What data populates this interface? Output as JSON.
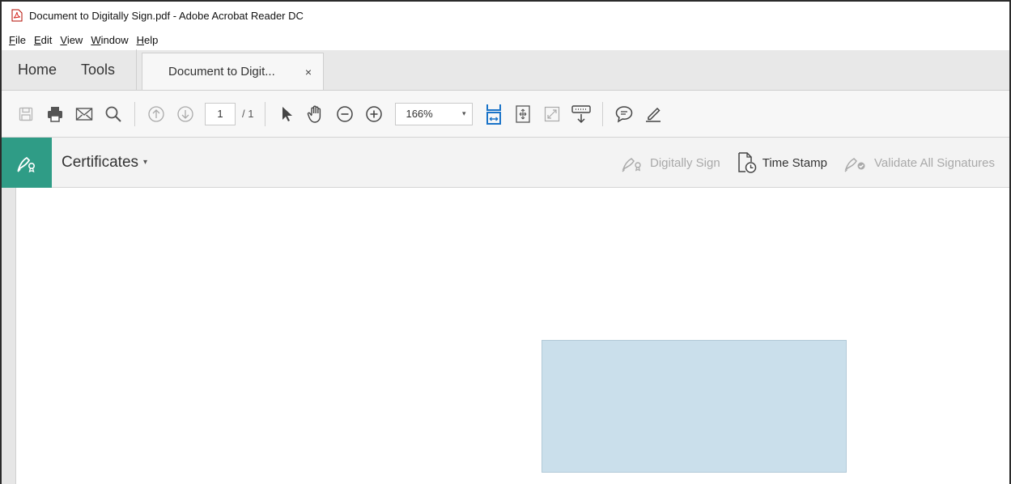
{
  "window": {
    "title": "Document to Digitally Sign.pdf - Adobe Acrobat Reader DC",
    "app_icon": "pdf-icon"
  },
  "menu": [
    {
      "underline": "F",
      "rest": "ile"
    },
    {
      "underline": "E",
      "rest": "dit"
    },
    {
      "underline": "V",
      "rest": "iew"
    },
    {
      "underline": "W",
      "rest": "indow"
    },
    {
      "underline": "H",
      "rest": "elp"
    }
  ],
  "tabs": {
    "home": "Home",
    "tools": "Tools",
    "document": "Document to Digit...",
    "close": "×"
  },
  "toolbar": {
    "page_current": "1",
    "page_total": "/ 1",
    "zoom": "166%",
    "zoom_caret": "▾",
    "accent": "#1a73c8"
  },
  "certificates": {
    "label": "Certificates",
    "caret": "▾",
    "accent": "#2f9c86",
    "actions": {
      "digitally_sign": "Digitally Sign",
      "time_stamp": "Time Stamp",
      "validate_all": "Validate All Signatures"
    }
  },
  "document": {
    "signature_field_color": "#cadfeb"
  }
}
